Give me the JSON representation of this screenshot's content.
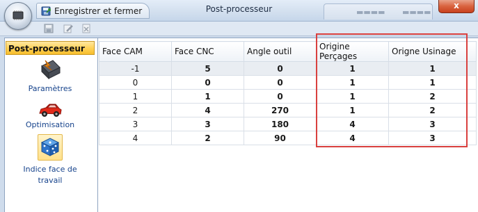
{
  "titlebar": {
    "app_orb_icon": "chip-icon",
    "save_close_label": "Enregistrer et fermer",
    "title": "Post-processeur",
    "close_glyph": "x",
    "close_color": "#d9633f"
  },
  "toolbar": {
    "buttons": [
      "save-icon",
      "edit-icon",
      "delete-icon"
    ]
  },
  "sidebar": {
    "header": "Post-processeur",
    "header_color": "#ffd35b",
    "items": [
      {
        "label": "Paramètres",
        "icon": "chip-settings-icon"
      },
      {
        "label": "Optimisation",
        "icon": "car-icon"
      },
      {
        "label": "Indice face de travail",
        "icon": "dice-icon",
        "selected": true
      }
    ]
  },
  "grid": {
    "columns": [
      "Face CAM",
      "Face CNC",
      "Angle outil",
      "Origine Perçages",
      "Origne Usinage"
    ],
    "rows": [
      [
        "-1",
        "5",
        "0",
        "1",
        "1"
      ],
      [
        "0",
        "0",
        "0",
        "1",
        "1"
      ],
      [
        "1",
        "1",
        "0",
        "1",
        "2"
      ],
      [
        "2",
        "4",
        "270",
        "1",
        "2"
      ],
      [
        "3",
        "3",
        "180",
        "4",
        "3"
      ],
      [
        "4",
        "2",
        "90",
        "4",
        "3"
      ]
    ],
    "highlight_color": "#d9403e"
  }
}
